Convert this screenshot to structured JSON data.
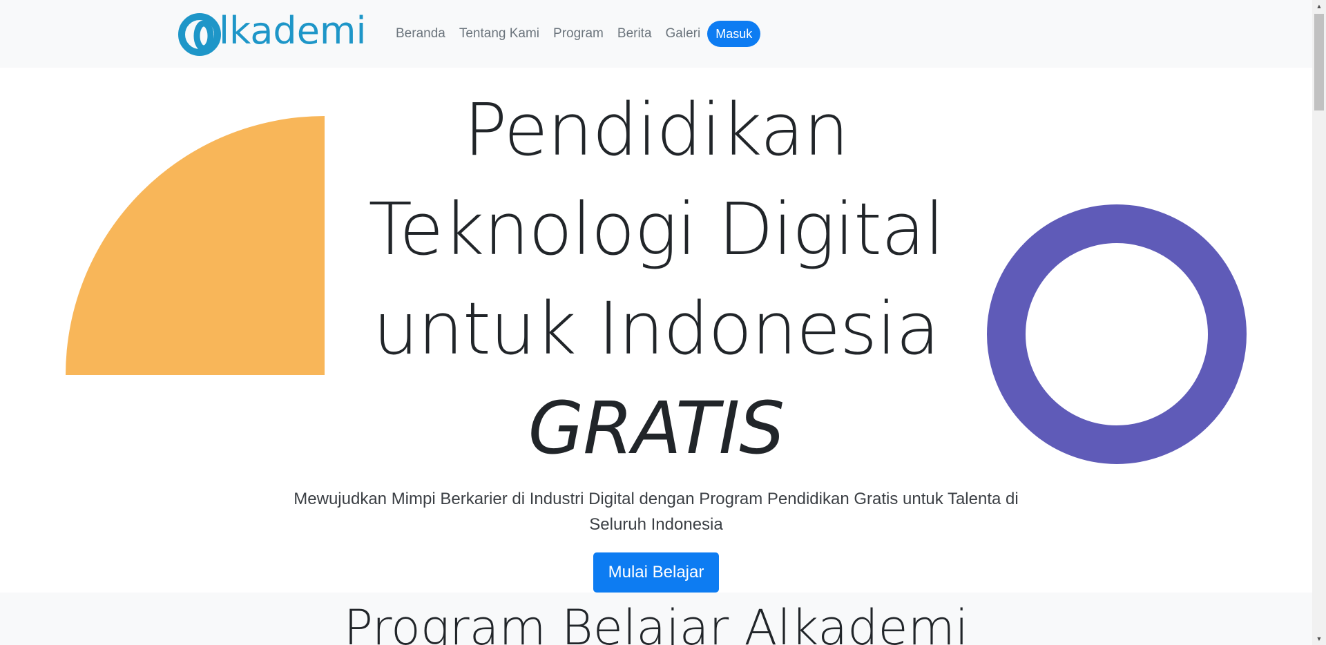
{
  "navbar": {
    "brand_name": "lkademi",
    "brand_logo_color": "#1e96c8",
    "links": [
      {
        "label": "Beranda"
      },
      {
        "label": "Tentang Kami"
      },
      {
        "label": "Program"
      },
      {
        "label": "Berita"
      },
      {
        "label": "Galeri"
      }
    ],
    "cta_label": "Masuk",
    "accent_color": "#0d7cf2"
  },
  "hero": {
    "title_lines": [
      "Pendidikan",
      "Teknologi Digital",
      "untuk Indonesia"
    ],
    "title_emphasis": "GRATIS",
    "subtitle": "Mewujudkan Mimpi Berkarier di Industri Digital dengan Program Pendidikan Gratis untuk Talenta di Seluruh Indonesia",
    "button_label": "Mulai Belajar",
    "decor_colors": {
      "quarter_circle": "#f8b659",
      "ring": "#5f5bb8"
    }
  },
  "program_section": {
    "title": "Program Belajar Alkademi"
  },
  "scrollbar": {
    "up_icon": "triangle-up-icon",
    "down_icon": "triangle-down-icon"
  }
}
